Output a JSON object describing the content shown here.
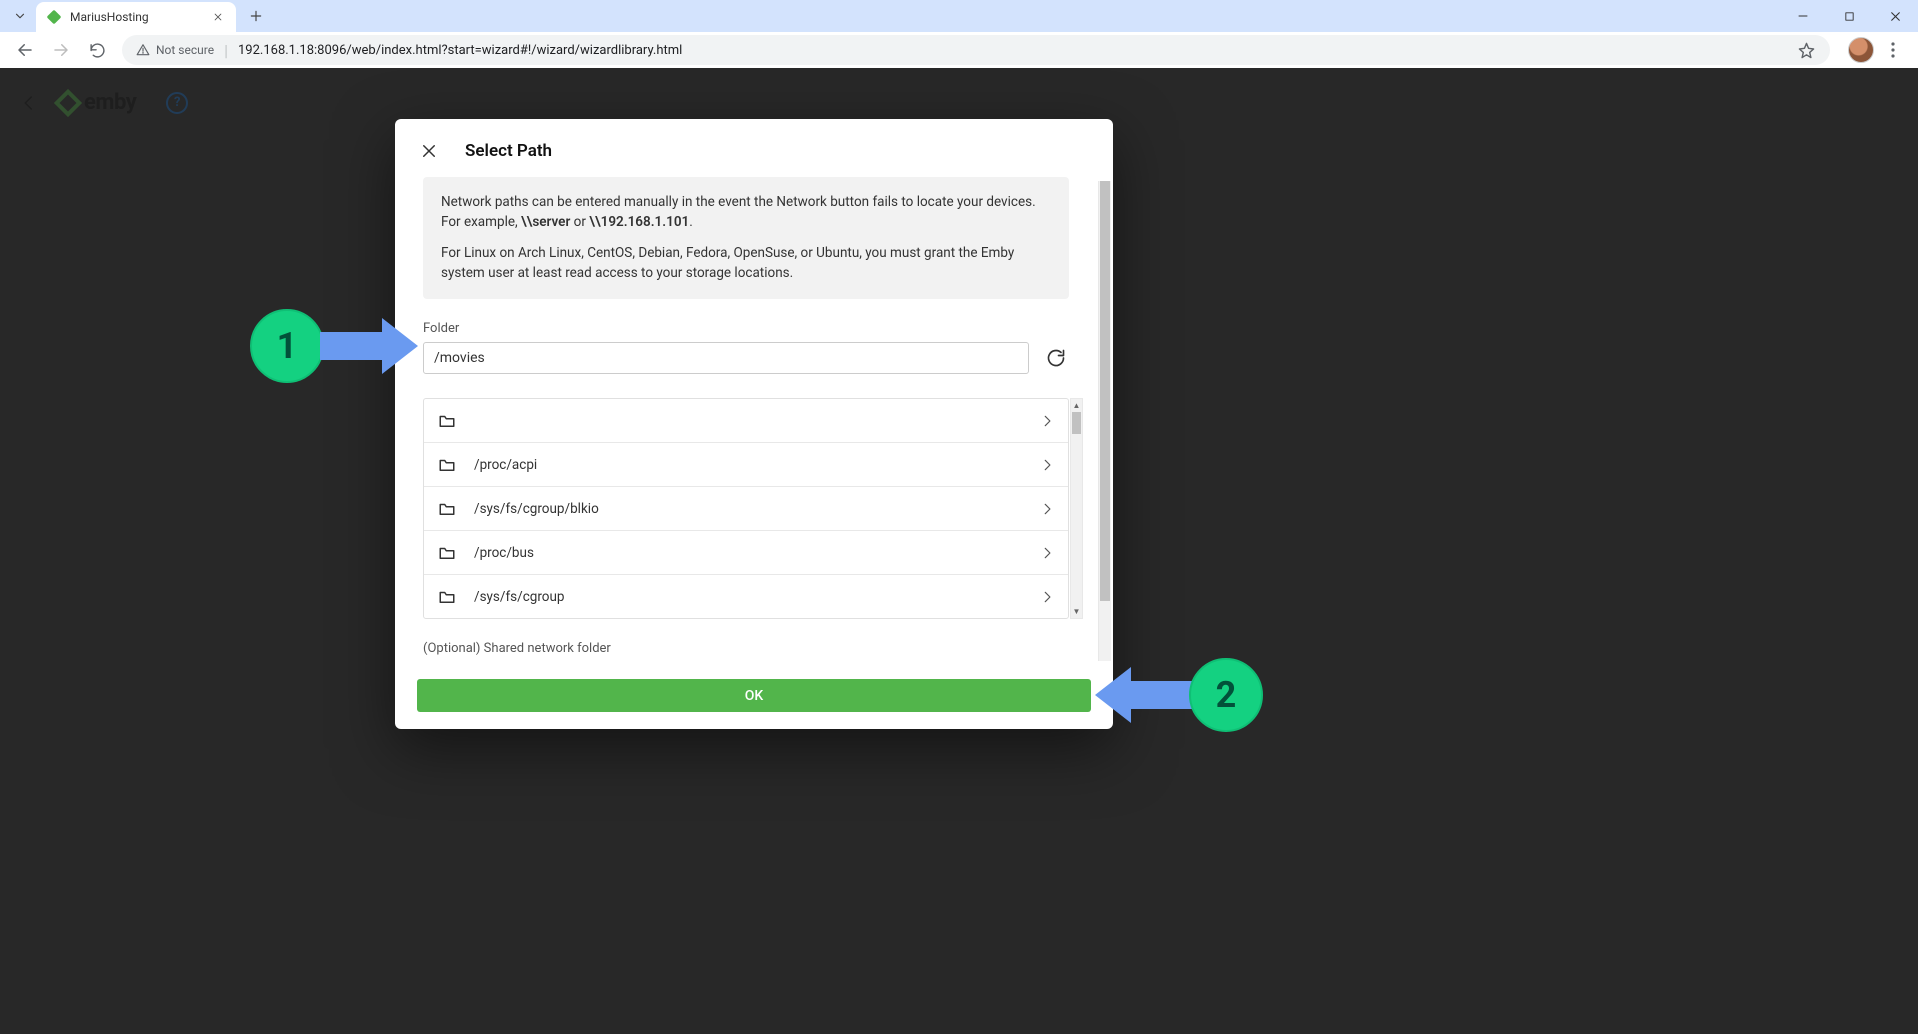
{
  "browser": {
    "tab_title": "MariusHosting",
    "security_label": "Not secure",
    "url": "192.168.1.18:8096/web/index.html?start=wizard#!/wizard/wizardlibrary.html"
  },
  "page": {
    "brand": "emby"
  },
  "dialog": {
    "title": "Select Path",
    "info_p1a": "Network paths can be entered manually in the event the Network button fails to locate your devices. For example, ",
    "info_p1b": "\\\\server",
    "info_p1c": " or ",
    "info_p1d": "\\\\192.168.1.101",
    "info_p1e": ".",
    "info_p2": "For Linux on Arch Linux, CentOS, Debian, Fedora, OpenSuse, or Ubuntu, you must grant the Emby system user at least read access to your storage locations.",
    "folder_label": "Folder",
    "folder_value": "/movies",
    "folders": [
      {
        "name": ""
      },
      {
        "name": "/proc/acpi"
      },
      {
        "name": "/sys/fs/cgroup/blkio"
      },
      {
        "name": "/proc/bus"
      },
      {
        "name": "/sys/fs/cgroup"
      }
    ],
    "optional_label": "(Optional) Shared network folder",
    "ok_label": "OK"
  },
  "annotations": {
    "c1": "1",
    "c2": "2"
  }
}
